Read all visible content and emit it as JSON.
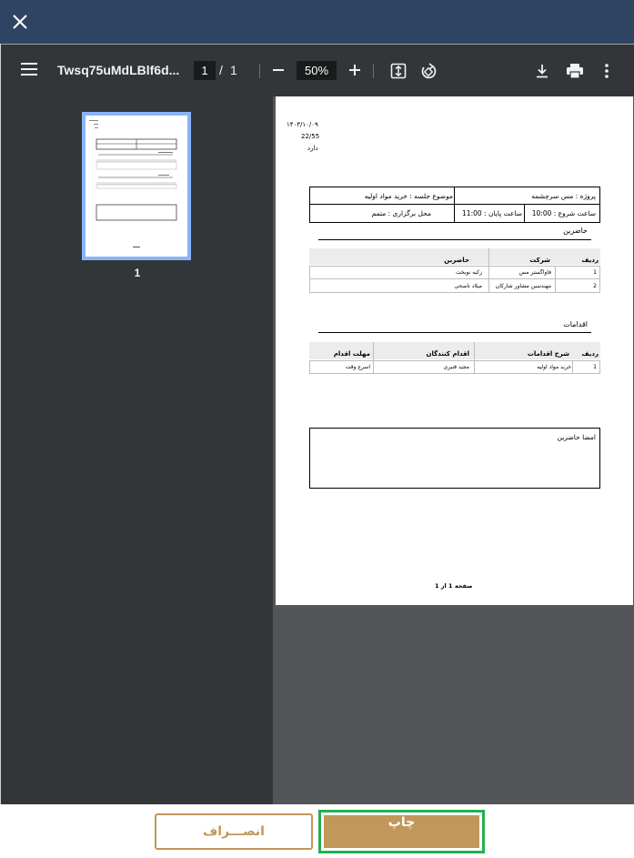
{
  "dialog": {
    "close_icon": "close-icon"
  },
  "toolbar": {
    "doc_title": "Twsq75uMdLBlf6d...",
    "page_current": "1",
    "page_separator": "/",
    "page_total": "1",
    "zoom": "50%",
    "icons": [
      "menu-icon",
      "zoom-out-icon",
      "zoom-in-icon",
      "fit-page-icon",
      "rotate-icon",
      "download-icon",
      "print-icon",
      "more-vert-icon"
    ]
  },
  "sidebar": {
    "thumbnail_label": "1"
  },
  "page": {
    "date": "۱۴۰۳/۱۰/۰۹",
    "number": "22/55",
    "status": "دارد",
    "project": "پروژه : مس سرچشمه",
    "subject": "موضوع جلسه : خرید مواد اولیه",
    "start_time": "ساعت شروع : 10:00",
    "end_time": "ساعت پایان : 11:00",
    "location": "محل برگزاری : متمم",
    "attendees_heading": "حاضرین",
    "attendees_table": {
      "headers": [
        "ردیف",
        "شرکت",
        "حاضرین"
      ],
      "rows": [
        [
          "1",
          "فاواگستر مس",
          "زکیه نوبخت"
        ],
        [
          "2",
          "مهندسین مشاور شارکان",
          "میلاد ناصحی"
        ]
      ]
    },
    "actions_heading": "اقدامات",
    "actions_table": {
      "headers": [
        "ردیف",
        "شرح اقدامات",
        "اقدام کنندگان",
        "مهلت اقدام"
      ],
      "rows": [
        [
          "1",
          "خرید مواد اولیه",
          "مجید قنبری",
          "اسرع وقت"
        ]
      ]
    },
    "signatures_label": "امضا حاضرین",
    "footer": "صفحه 1 از 1"
  },
  "buttons": {
    "print": "چاپ",
    "cancel": "انصـــراف"
  },
  "colors": {
    "topbar": "#2f4463",
    "toolbar": "#323639",
    "viewer_bg": "#525659",
    "accent": "#c2975a",
    "highlight": "#22b14c"
  }
}
